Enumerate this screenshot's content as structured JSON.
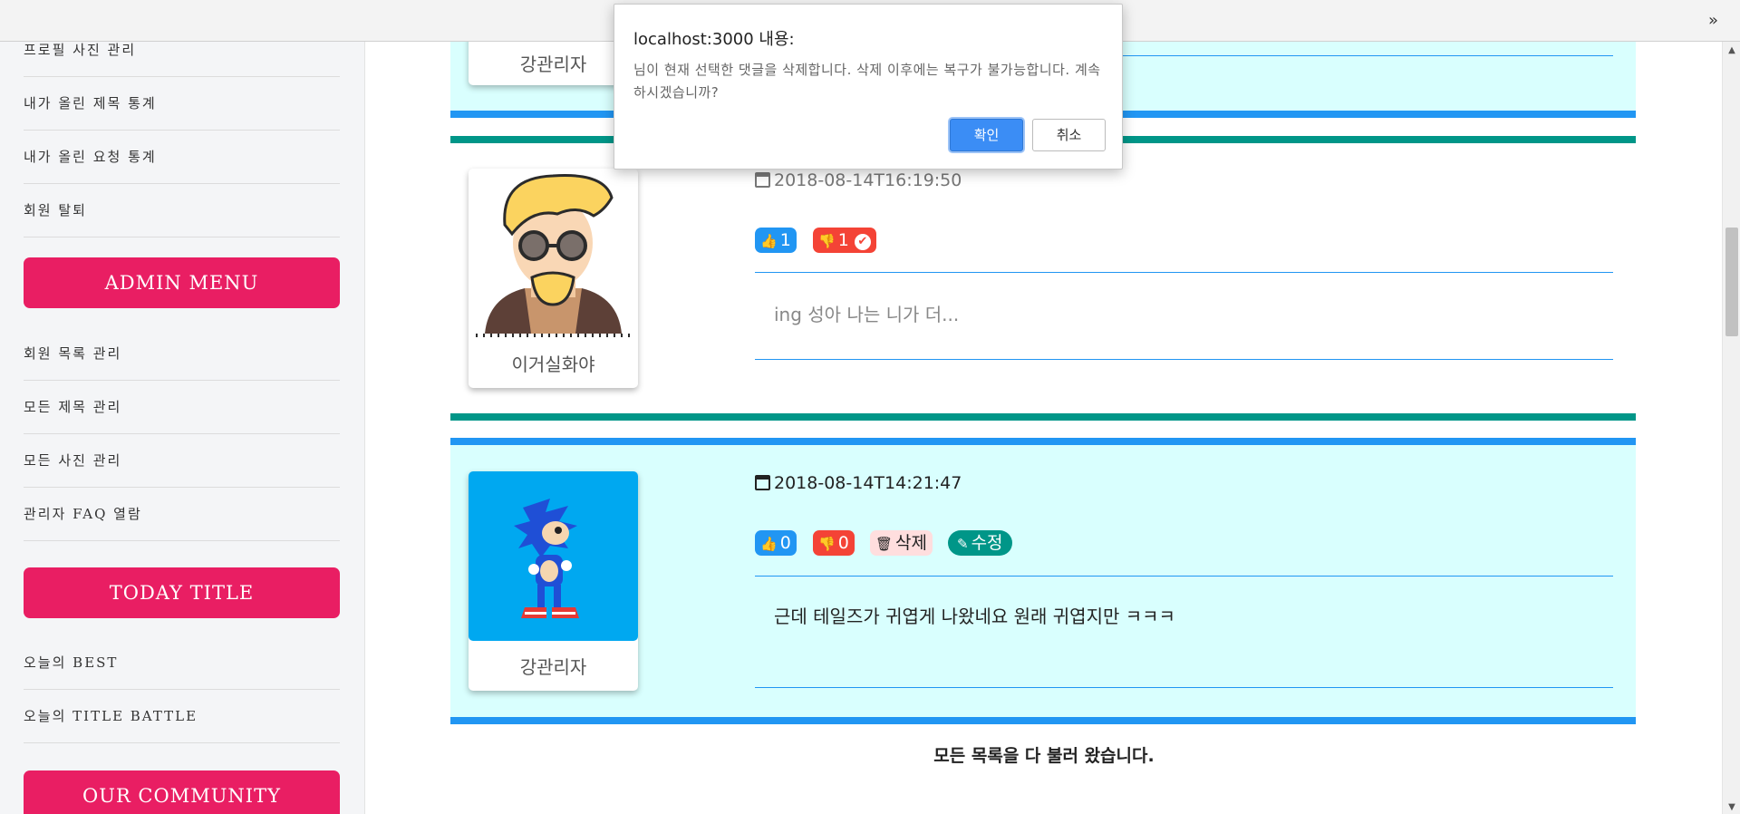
{
  "browser": {
    "overflow_label": "»"
  },
  "sidebar": {
    "links_top": [
      "프로필 사진 관리",
      "내가 올린 제목 통계",
      "내가 올린 요청 통계",
      "회원 탈퇴"
    ],
    "admin_menu_label": "ADMIN MENU",
    "admin_links": [
      "회원 목록 관리",
      "모든 제목 관리",
      "모든 사진 관리",
      "관리자 FAQ 열람"
    ],
    "today_title_label": "TODAY TITLE",
    "today_links": [
      "오늘의 BEST",
      "오늘의 TITLE BATTLE"
    ],
    "community_label": "OUR COMMUNITY"
  },
  "comments": [
    {
      "author": "강관리자"
    },
    {
      "author": "이거실화야",
      "date": "2018-08-14T16:19:50",
      "likes": "1",
      "dislikes": "1",
      "text": "ing 성아 나는 니가 더..."
    },
    {
      "author": "강관리자",
      "date": "2018-08-14T14:21:47",
      "likes": "0",
      "dislikes": "0",
      "delete_label": "삭제",
      "edit_label": "수정",
      "text": "근데 테일즈가 귀엽게 나왔네요 원래 귀엽지만 ㅋㅋㅋ"
    }
  ],
  "footer_text": "모든 목록을 다 불러 왔습니다.",
  "dialog": {
    "title": "localhost:3000 내용:",
    "message": "님이 현재 선택한 댓글을 삭제합니다. 삭제 이후에는 복구가 불가능합니다. 계속 하시겠습니까?",
    "ok_label": "확인",
    "cancel_label": "취소"
  },
  "colors": {
    "accent_pink": "#e91e63",
    "blue": "#2196f3",
    "green": "#009688",
    "panel_bg": "#d9fffe",
    "dislike_red": "#f44336"
  }
}
